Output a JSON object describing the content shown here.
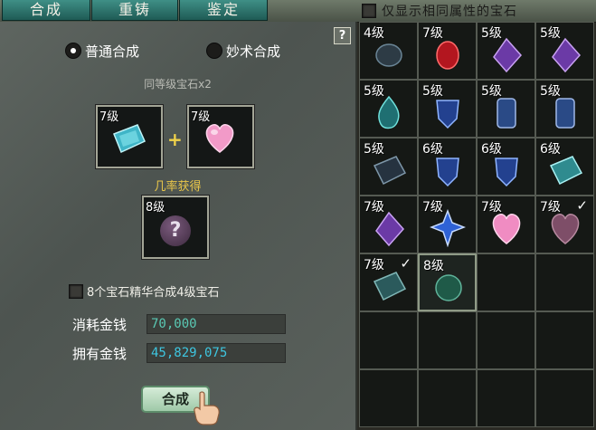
{
  "tabs": [
    "合成",
    "重铸",
    "鉴定"
  ],
  "filter": {
    "label": "仅显示相同属性的宝石",
    "checked": false
  },
  "help_label": "?",
  "modes": [
    {
      "label": "普通合成",
      "selected": true
    },
    {
      "label": "妙术合成",
      "selected": false
    }
  ],
  "recipe": {
    "subtitle": "同等级宝石x2",
    "input_1": {
      "level": "7级",
      "gem": "teal-prism-gem"
    },
    "input_2": {
      "level": "7级",
      "gem": "pink-heart-gem"
    },
    "plus": "+",
    "probability_label": "几率获得",
    "output": {
      "level": "8级",
      "mark": "?"
    }
  },
  "essence": {
    "label": "8个宝石精华合成4级宝石",
    "checked": false
  },
  "cost": {
    "label": "消耗金钱",
    "value": "70,000"
  },
  "owned": {
    "label": "拥有金钱",
    "value": "45,829,075"
  },
  "synthesize_label": "合成",
  "colors": {
    "tab": "#2f7a72",
    "cost_text": "#5ac9b4",
    "owned_text": "#3ec6e0",
    "probability_text": "#e8c64a"
  },
  "inventory": [
    {
      "level": "4级",
      "gem": "dark-round",
      "check": ""
    },
    {
      "level": "7级",
      "gem": "red-oval",
      "check": ""
    },
    {
      "level": "5级",
      "gem": "purple-diamond",
      "check": ""
    },
    {
      "level": "5级",
      "gem": "purple-diamond",
      "check": ""
    },
    {
      "level": "5级",
      "gem": "teal-drop",
      "check": ""
    },
    {
      "level": "5级",
      "gem": "blue-shield",
      "check": ""
    },
    {
      "level": "5级",
      "gem": "blue-crystal",
      "check": ""
    },
    {
      "level": "5级",
      "gem": "blue-crystal",
      "check": ""
    },
    {
      "level": "5级",
      "gem": "dark-prism",
      "check": ""
    },
    {
      "level": "6级",
      "gem": "blue-shield",
      "check": ""
    },
    {
      "level": "6级",
      "gem": "blue-shield",
      "check": ""
    },
    {
      "level": "6级",
      "gem": "teal-prism",
      "check": ""
    },
    {
      "level": "7级",
      "gem": "purple-diamond",
      "check": ""
    },
    {
      "level": "7级",
      "gem": "blue-star",
      "check": ""
    },
    {
      "level": "7级",
      "gem": "pink-heart",
      "check": ""
    },
    {
      "level": "7级",
      "gem": "pink-heart-faded",
      "check": "✓"
    },
    {
      "level": "7级",
      "gem": "teal-prism-faded",
      "check": "✓"
    },
    {
      "level": "8级",
      "gem": "green-round",
      "check": ""
    }
  ]
}
